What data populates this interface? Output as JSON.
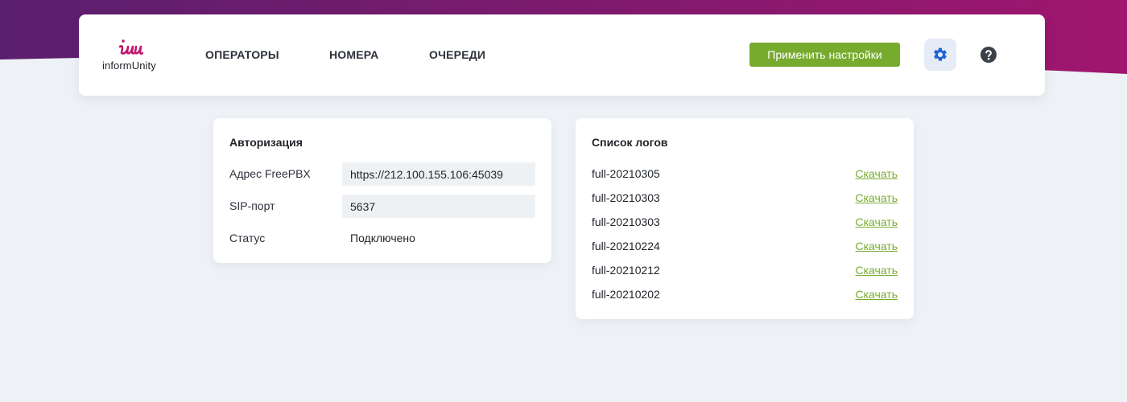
{
  "brand": {
    "logo_text": "informUnity",
    "colors": {
      "gradient_start": "#5a1f6e",
      "gradient_end": "#a0166e",
      "accent_green": "#77ab2e",
      "logo_magenta": "#c2186f"
    }
  },
  "nav": {
    "items": [
      {
        "label": "ОПЕРАТОРЫ"
      },
      {
        "label": "НОМЕРА"
      },
      {
        "label": "ОЧЕРЕДИ"
      }
    ]
  },
  "toolbar": {
    "apply_label": "Применить настройки",
    "settings_icon": "gear-icon",
    "help_icon": "help-icon"
  },
  "auth": {
    "title": "Авторизация",
    "fields": {
      "freepbx_label": "Адрес FreePBX",
      "freepbx_value": "https://212.100.155.106:45039",
      "sip_label": "SIP-порт",
      "sip_value": "5637",
      "status_label": "Статус",
      "status_value": "Подключено"
    }
  },
  "logs": {
    "title": "Список логов",
    "items": [
      {
        "name": "full-20210305",
        "action": "Скачать"
      },
      {
        "name": "full-20210303",
        "action": "Скачать"
      },
      {
        "name": "full-20210303",
        "action": "Скачать"
      },
      {
        "name": "full-20210224",
        "action": "Скачать"
      },
      {
        "name": "full-20210212",
        "action": "Скачать"
      },
      {
        "name": "full-20210202",
        "action": "Скачать"
      }
    ]
  }
}
